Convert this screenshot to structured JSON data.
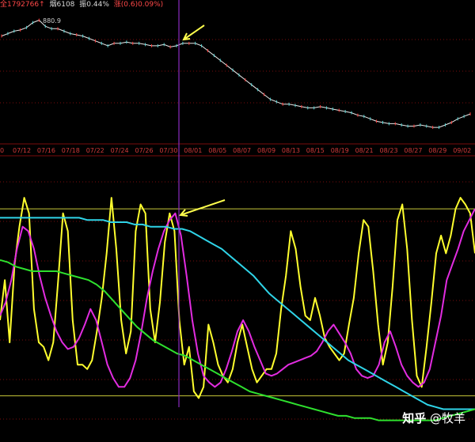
{
  "header": {
    "vol_text": "全1792766↑",
    "hand_text": "烟6108",
    "amp_text": "振0.44%",
    "chg_text": "涨(0.6)0.09%)"
  },
  "colors": {
    "price": "#e9e9e9",
    "up_tick": "#ff3b3b",
    "down_tick": "#4fd0d0",
    "grid": "#7a0d0d",
    "axis_text": "#d23a3a",
    "cursor": "#8a2bbf",
    "arrow": "#ffff4d",
    "level": "#c8c83a",
    "yellow": "#ffff2e",
    "magenta": "#e22ce0",
    "cyan": "#2fd4e8",
    "green": "#2ee02e"
  },
  "watermark": {
    "site": "知乎",
    "author": "@牧羊"
  },
  "chart_data": [
    {
      "type": "line",
      "title": "",
      "annotation": "880.9",
      "x_ticks": [
        "0",
        "07/12",
        "07/16",
        "07/18",
        "07/22",
        "07/24",
        "07/26",
        "07/30",
        "08/01",
        "08/05",
        "08/07",
        "08/09",
        "08/13",
        "08/15",
        "08/19",
        "08/21",
        "08/23",
        "08/27",
        "08/29",
        "09/02"
      ],
      "series": [
        {
          "values": [
            86,
            88,
            90,
            91,
            93,
            97,
            99,
            94,
            92,
            92,
            90,
            88,
            87,
            86,
            84,
            82,
            80,
            78,
            80,
            80,
            81,
            80,
            80,
            79,
            78,
            78,
            79,
            77,
            78,
            80,
            80,
            80,
            78,
            74,
            70,
            66,
            62,
            58,
            54,
            50,
            46,
            42,
            38,
            34,
            32,
            30,
            30,
            29,
            28,
            27,
            27,
            28,
            27,
            26,
            25,
            24,
            23,
            21,
            20,
            18,
            16,
            15,
            14,
            14,
            13,
            12,
            12,
            13,
            12,
            11,
            11,
            13,
            15,
            18,
            20,
            22
          ]
        }
      ],
      "ylim": [
        0,
        100
      ]
    },
    {
      "type": "line",
      "title": "",
      "levels": [
        90,
        6
      ],
      "series": [
        {
          "color": "yellow",
          "values": [
            40,
            58,
            30,
            65,
            82,
            95,
            88,
            45,
            30,
            28,
            22,
            30,
            58,
            88,
            80,
            40,
            20,
            20,
            18,
            22,
            35,
            50,
            70,
            95,
            72,
            40,
            25,
            35,
            80,
            92,
            88,
            45,
            30,
            48,
            75,
            88,
            80,
            40,
            20,
            28,
            8,
            5,
            10,
            38,
            30,
            20,
            15,
            12,
            18,
            30,
            38,
            28,
            18,
            12,
            15,
            18,
            18,
            25,
            45,
            60,
            80,
            72,
            55,
            42,
            40,
            50,
            42,
            32,
            28,
            25,
            22,
            25,
            38,
            50,
            70,
            85,
            82,
            62,
            38,
            20,
            30,
            55,
            85,
            92,
            72,
            40,
            15,
            10,
            28,
            48,
            70,
            78,
            70,
            78,
            90,
            95,
            92,
            88,
            70
          ]
        },
        {
          "color": "magenta",
          "values": [
            42,
            48,
            58,
            72,
            82,
            80,
            72,
            60,
            50,
            42,
            35,
            30,
            27,
            28,
            32,
            38,
            45,
            40,
            30,
            20,
            14,
            10,
            10,
            14,
            22,
            35,
            50,
            62,
            72,
            80,
            85,
            88,
            78,
            60,
            40,
            25,
            15,
            12,
            10,
            12,
            18,
            26,
            35,
            40,
            35,
            28,
            22,
            16,
            15,
            16,
            18,
            20,
            21,
            22,
            23,
            24,
            26,
            30,
            35,
            38,
            34,
            30,
            25,
            18,
            15,
            14,
            15,
            20,
            30,
            35,
            28,
            20,
            15,
            12,
            10,
            12,
            18,
            30,
            42,
            58,
            65,
            72,
            80,
            85,
            90
          ]
        },
        {
          "color": "cyan",
          "values": [
            86,
            86,
            86,
            86,
            86,
            86,
            86,
            86,
            86,
            86,
            86,
            85,
            85,
            85,
            84,
            84,
            84,
            83,
            83,
            82,
            82,
            82,
            81,
            81,
            80,
            78,
            76,
            74,
            72,
            69,
            66,
            63,
            60,
            56,
            52,
            49,
            46,
            43,
            40,
            37,
            34,
            31,
            28,
            25,
            22,
            20,
            18,
            16,
            14,
            12,
            10,
            8,
            6,
            4,
            2,
            1,
            0,
            0,
            0,
            0,
            0
          ]
        },
        {
          "color": "green",
          "values": [
            67,
            66,
            64,
            63,
            62,
            62,
            62,
            62,
            61,
            60,
            59,
            58,
            56,
            53,
            49,
            45,
            41,
            37,
            34,
            31,
            29,
            27,
            25,
            24,
            22,
            20,
            18,
            16,
            14,
            12,
            10,
            8,
            7,
            6,
            5,
            4,
            3,
            2,
            1,
            0,
            -1,
            -2,
            -3,
            -3,
            -4,
            -4,
            -4,
            -5,
            -5,
            -5,
            -5,
            -5,
            -5,
            -5,
            -5,
            -4,
            -3,
            -2,
            -1,
            0
          ]
        }
      ],
      "ylim": [
        -8,
        100
      ]
    }
  ]
}
